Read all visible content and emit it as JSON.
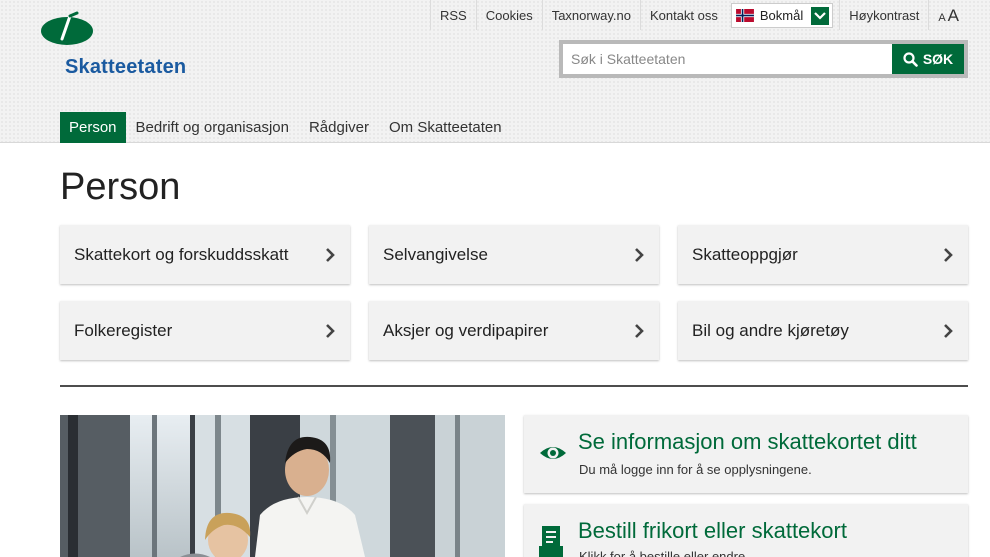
{
  "brand": {
    "name": "Skatteetaten"
  },
  "toplinks": {
    "rss": "RSS",
    "cookies": "Cookies",
    "taxnorway": "Taxnorway.no",
    "contact": "Kontakt oss",
    "language": "Bokmål",
    "high_contrast": "Høykontrast",
    "text_small": "A",
    "text_large": "A"
  },
  "search": {
    "placeholder": "Søk i Skatteetaten",
    "button": "SØK"
  },
  "nav": {
    "person": "Person",
    "business": "Bedrift og organisasjon",
    "advisor": "Rådgiver",
    "about": "Om Skatteetaten"
  },
  "page": {
    "title": "Person"
  },
  "tiles": [
    {
      "label": "Skattekort og forskuddsskatt"
    },
    {
      "label": "Selvangivelse"
    },
    {
      "label": "Skatteoppgjør"
    },
    {
      "label": "Folkeregister"
    },
    {
      "label": "Aksjer og verdipapirer"
    },
    {
      "label": "Bil og andre kjøretøy"
    }
  ],
  "cards": [
    {
      "title": "Se informasjon om skattekortet ditt",
      "subtitle": "Du må logge inn for å se opplysningene.",
      "icon": "eye-icon"
    },
    {
      "title": "Bestill frikort eller skattekort",
      "subtitle": "Klikk for å bestille eller endre",
      "icon": "document-icon"
    }
  ],
  "colors": {
    "brand_green": "#006a3a",
    "brand_blue": "#1a5aa0",
    "tile_bg": "#f2f2f2"
  }
}
